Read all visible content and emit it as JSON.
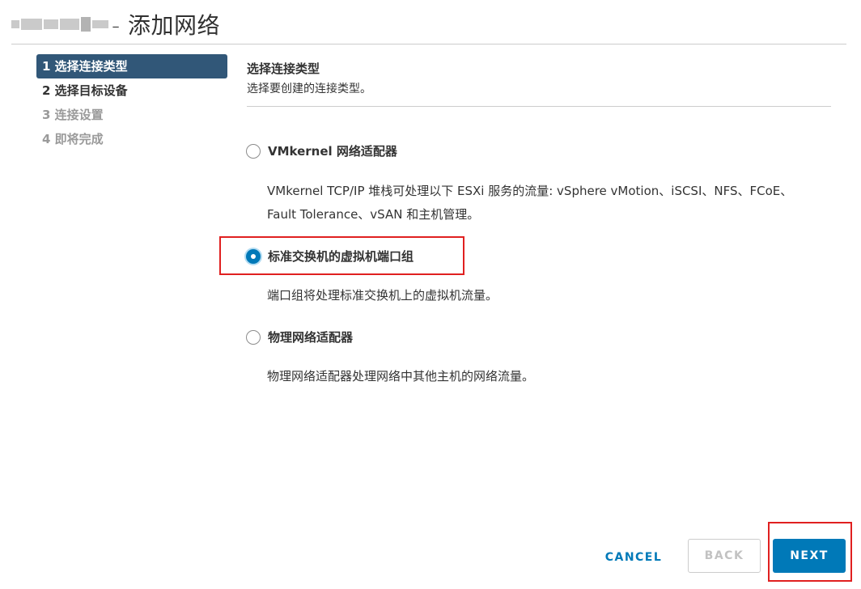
{
  "header": {
    "title": "- 添加网络"
  },
  "nav": {
    "steps": [
      {
        "label": "1 选择连接类型",
        "state": "active"
      },
      {
        "label": "2 选择目标设备",
        "state": "enabled"
      },
      {
        "label": "3 连接设置",
        "state": "disabled"
      },
      {
        "label": "4 即将完成",
        "state": "disabled"
      }
    ]
  },
  "content": {
    "title": "选择连接类型",
    "subtitle": "选择要创建的连接类型。",
    "options": [
      {
        "label": "VMkernel 网络适配器",
        "checked": false,
        "description_line1": "VMkernel TCP/IP 堆栈可处理以下 ESXi 服务的流量: vSphere vMotion、iSCSI、NFS、FCoE、",
        "description_line2": "Fault Tolerance、vSAN 和主机管理。"
      },
      {
        "label": "标准交换机的虚拟机端口组",
        "checked": true,
        "description_line1": "端口组将处理标准交换机上的虚拟机流量。"
      },
      {
        "label": "物理网络适配器",
        "checked": false,
        "description_line1": "物理网络适配器处理网络中其他主机的网络流量。"
      }
    ]
  },
  "footer": {
    "cancel_label": "CANCEL",
    "back_label": "BACK",
    "next_label": "NEXT"
  },
  "colors": {
    "accent": "#0079b8",
    "nav_active": "#315778",
    "highlight": "#e02020"
  }
}
